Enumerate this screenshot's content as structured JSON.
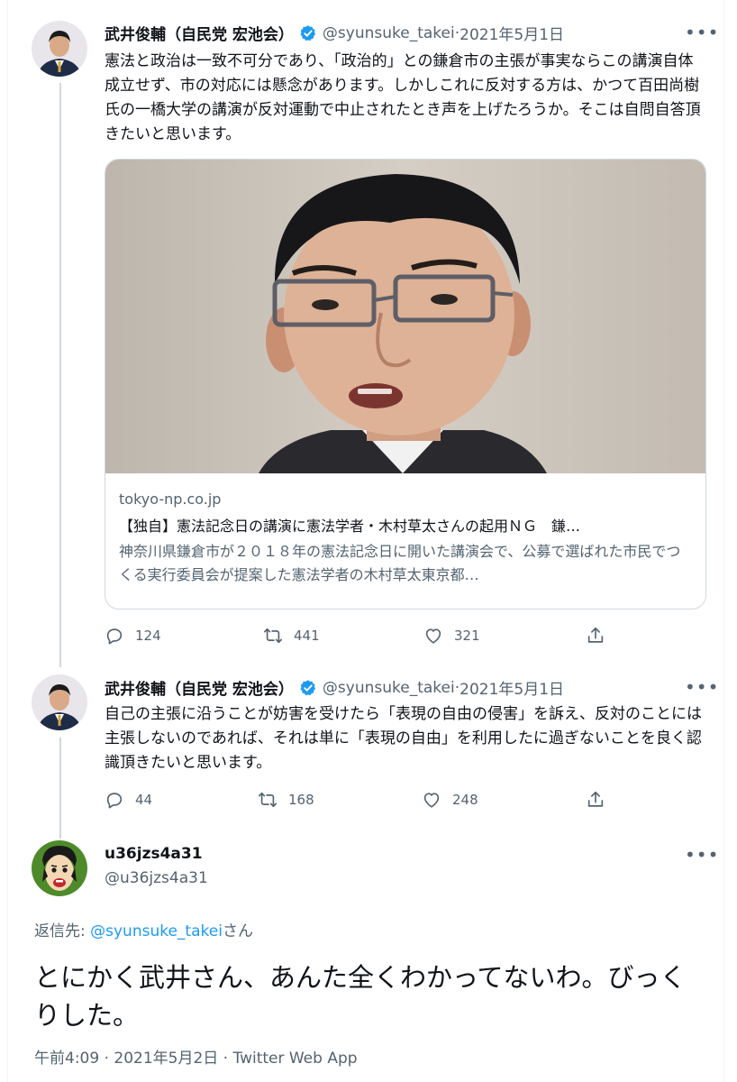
{
  "tweet1": {
    "name": "武井俊輔（自民党 宏池会）",
    "handle": "@syunsuke_takei",
    "date": "2021年5月1日",
    "text": "憲法と政治は一致不可分であり、「政治的」との鎌倉市の主張が事実ならこの講演自体成立せず、市の対応には懸念があります。しかしこれに反対する方は、かつて百田尚樹氏の一橋大学の講演が反対運動で中止されたとき声を上げたろうか。そこは自問自答頂きたいと思います。",
    "card": {
      "domain": "tokyo-np.co.jp",
      "title": "【独自】憲法記念日の講演に憲法学者・木村草太さんの起用ＮＧ　鎌…",
      "description": "神奈川県鎌倉市が２０１８年の憲法記念日に開いた講演会で、公募で選ばれた市民でつくる実行委員会が提案した憲法学者の木村草太東京都…"
    },
    "replies": "124",
    "retweets": "441",
    "likes": "321"
  },
  "tweet2": {
    "name": "武井俊輔（自民党 宏池会）",
    "handle": "@syunsuke_takei",
    "date": "2021年5月1日",
    "text": "自己の主張に沿うことが妨害を受けたら「表現の自由の侵害」を訴え、反対のことには主張しないのであれば、それは単に「表現の自由」を利用したに過ぎないことを良く認識頂きたいと思います。",
    "replies": "44",
    "retweets": "168",
    "likes": "248"
  },
  "main_tweet": {
    "name": "u36jzs4a31",
    "handle": "@u36jzs4a31",
    "reply_prefix": "返信先: ",
    "reply_target": "@syunsuke_takei",
    "reply_suffix": "さん",
    "text": "とにかく武井さん、あんた全くわかってないわ。びっくりした。",
    "timestamp": "午前4:09 · 2021年5月2日 · Twitter Web App"
  },
  "ui": {
    "more_label": "•••",
    "date_separator": " · "
  },
  "colors": {
    "verified": "#1d9bf0",
    "link": "#1d9bf0",
    "muted": "#536471",
    "thread_line": "#cfd9de"
  }
}
